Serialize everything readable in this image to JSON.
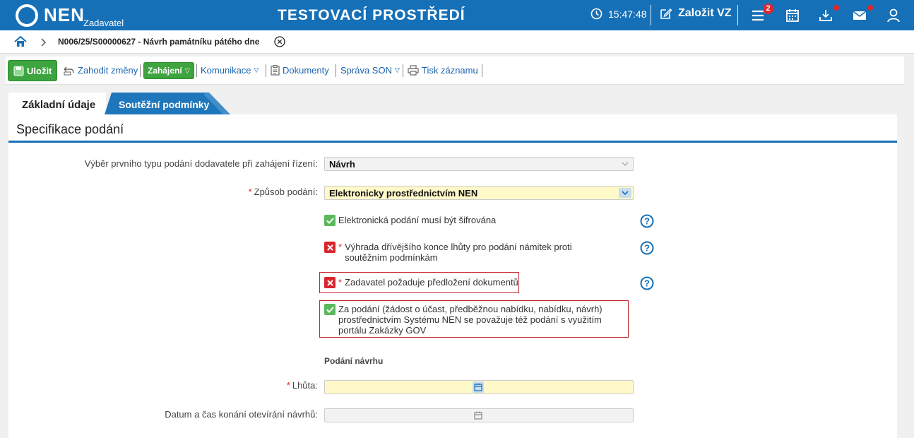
{
  "header": {
    "logo_text": "NEN",
    "logo_subtitle": "Zadavatel",
    "environment_title": "TESTOVACÍ PROSTŘEDÍ",
    "clock": "15:47:48",
    "create_label": "Založit VZ",
    "menu_badge": "2",
    "accent_color": "#1670b7"
  },
  "breadcrumb": {
    "title": "N006/25/S00000627 - Návrh památníku pátého dne"
  },
  "toolbar": {
    "save_label": "Uložit",
    "discard_label": "Zahodit změny",
    "start_label": "Zahájení",
    "communication_label": "Komunikace",
    "documents_label": "Dokumenty",
    "son_label": "Správa SON",
    "print_label": "Tisk záznamu"
  },
  "tabs": [
    {
      "label": "Základní údaje",
      "active": true
    },
    {
      "label": "Soutěžní podmínky",
      "active": false
    }
  ],
  "section": {
    "title": "Specifikace podání",
    "first_type_label": "Výběr prvního typu podání dodavatele při zahájení řízení:",
    "first_type_value": "Návrh",
    "method_label": "Způsob podání:",
    "method_value": "Elektronicky prostřednictvím NEN",
    "check_encrypted": "Elektronická podání musí být šifrována",
    "check_reservation": "Výhrada dřívějšího konce lhůty pro podání námitek proti soutěžním podmínkám",
    "check_documents": "Zadavatel požaduje předložení dokumentů",
    "check_gov": "Za podání (žádost o účast, předběžnou nabídku, nabídku, návrh) prostřednictvím Systému NEN se považuje též podání s využitím portálu Zakázky GOV",
    "submission_heading": "Podání návrhu",
    "deadline_label": "Lhůta:",
    "opening_label": "Datum a čas konání otevírání návrhů:"
  }
}
